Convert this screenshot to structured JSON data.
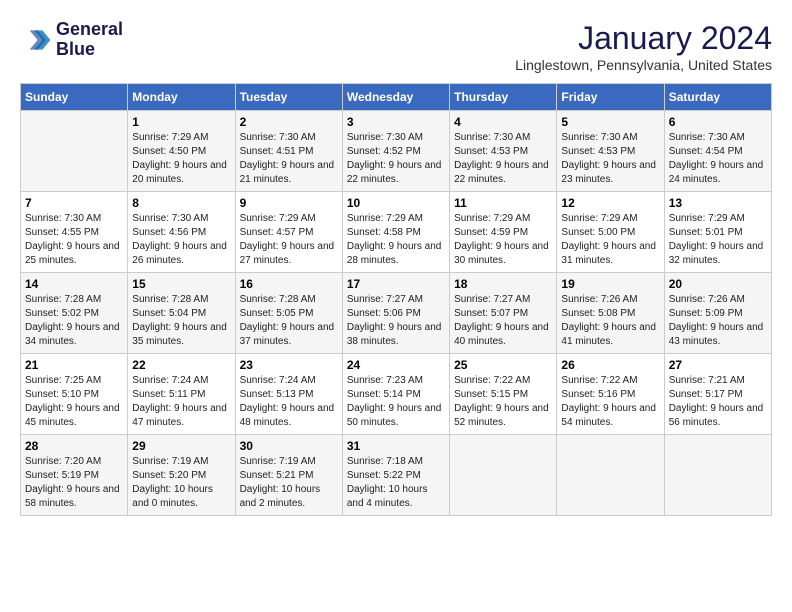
{
  "header": {
    "logo_line1": "General",
    "logo_line2": "Blue",
    "month_title": "January 2024",
    "location": "Linglestown, Pennsylvania, United States"
  },
  "days_of_week": [
    "Sunday",
    "Monday",
    "Tuesday",
    "Wednesday",
    "Thursday",
    "Friday",
    "Saturday"
  ],
  "weeks": [
    [
      {
        "day": "",
        "sunrise": "",
        "sunset": "",
        "daylight": ""
      },
      {
        "day": "1",
        "sunrise": "Sunrise: 7:29 AM",
        "sunset": "Sunset: 4:50 PM",
        "daylight": "Daylight: 9 hours and 20 minutes."
      },
      {
        "day": "2",
        "sunrise": "Sunrise: 7:30 AM",
        "sunset": "Sunset: 4:51 PM",
        "daylight": "Daylight: 9 hours and 21 minutes."
      },
      {
        "day": "3",
        "sunrise": "Sunrise: 7:30 AM",
        "sunset": "Sunset: 4:52 PM",
        "daylight": "Daylight: 9 hours and 22 minutes."
      },
      {
        "day": "4",
        "sunrise": "Sunrise: 7:30 AM",
        "sunset": "Sunset: 4:53 PM",
        "daylight": "Daylight: 9 hours and 22 minutes."
      },
      {
        "day": "5",
        "sunrise": "Sunrise: 7:30 AM",
        "sunset": "Sunset: 4:53 PM",
        "daylight": "Daylight: 9 hours and 23 minutes."
      },
      {
        "day": "6",
        "sunrise": "Sunrise: 7:30 AM",
        "sunset": "Sunset: 4:54 PM",
        "daylight": "Daylight: 9 hours and 24 minutes."
      }
    ],
    [
      {
        "day": "7",
        "sunrise": "Sunrise: 7:30 AM",
        "sunset": "Sunset: 4:55 PM",
        "daylight": "Daylight: 9 hours and 25 minutes."
      },
      {
        "day": "8",
        "sunrise": "Sunrise: 7:30 AM",
        "sunset": "Sunset: 4:56 PM",
        "daylight": "Daylight: 9 hours and 26 minutes."
      },
      {
        "day": "9",
        "sunrise": "Sunrise: 7:29 AM",
        "sunset": "Sunset: 4:57 PM",
        "daylight": "Daylight: 9 hours and 27 minutes."
      },
      {
        "day": "10",
        "sunrise": "Sunrise: 7:29 AM",
        "sunset": "Sunset: 4:58 PM",
        "daylight": "Daylight: 9 hours and 28 minutes."
      },
      {
        "day": "11",
        "sunrise": "Sunrise: 7:29 AM",
        "sunset": "Sunset: 4:59 PM",
        "daylight": "Daylight: 9 hours and 30 minutes."
      },
      {
        "day": "12",
        "sunrise": "Sunrise: 7:29 AM",
        "sunset": "Sunset: 5:00 PM",
        "daylight": "Daylight: 9 hours and 31 minutes."
      },
      {
        "day": "13",
        "sunrise": "Sunrise: 7:29 AM",
        "sunset": "Sunset: 5:01 PM",
        "daylight": "Daylight: 9 hours and 32 minutes."
      }
    ],
    [
      {
        "day": "14",
        "sunrise": "Sunrise: 7:28 AM",
        "sunset": "Sunset: 5:02 PM",
        "daylight": "Daylight: 9 hours and 34 minutes."
      },
      {
        "day": "15",
        "sunrise": "Sunrise: 7:28 AM",
        "sunset": "Sunset: 5:04 PM",
        "daylight": "Daylight: 9 hours and 35 minutes."
      },
      {
        "day": "16",
        "sunrise": "Sunrise: 7:28 AM",
        "sunset": "Sunset: 5:05 PM",
        "daylight": "Daylight: 9 hours and 37 minutes."
      },
      {
        "day": "17",
        "sunrise": "Sunrise: 7:27 AM",
        "sunset": "Sunset: 5:06 PM",
        "daylight": "Daylight: 9 hours and 38 minutes."
      },
      {
        "day": "18",
        "sunrise": "Sunrise: 7:27 AM",
        "sunset": "Sunset: 5:07 PM",
        "daylight": "Daylight: 9 hours and 40 minutes."
      },
      {
        "day": "19",
        "sunrise": "Sunrise: 7:26 AM",
        "sunset": "Sunset: 5:08 PM",
        "daylight": "Daylight: 9 hours and 41 minutes."
      },
      {
        "day": "20",
        "sunrise": "Sunrise: 7:26 AM",
        "sunset": "Sunset: 5:09 PM",
        "daylight": "Daylight: 9 hours and 43 minutes."
      }
    ],
    [
      {
        "day": "21",
        "sunrise": "Sunrise: 7:25 AM",
        "sunset": "Sunset: 5:10 PM",
        "daylight": "Daylight: 9 hours and 45 minutes."
      },
      {
        "day": "22",
        "sunrise": "Sunrise: 7:24 AM",
        "sunset": "Sunset: 5:11 PM",
        "daylight": "Daylight: 9 hours and 47 minutes."
      },
      {
        "day": "23",
        "sunrise": "Sunrise: 7:24 AM",
        "sunset": "Sunset: 5:13 PM",
        "daylight": "Daylight: 9 hours and 48 minutes."
      },
      {
        "day": "24",
        "sunrise": "Sunrise: 7:23 AM",
        "sunset": "Sunset: 5:14 PM",
        "daylight": "Daylight: 9 hours and 50 minutes."
      },
      {
        "day": "25",
        "sunrise": "Sunrise: 7:22 AM",
        "sunset": "Sunset: 5:15 PM",
        "daylight": "Daylight: 9 hours and 52 minutes."
      },
      {
        "day": "26",
        "sunrise": "Sunrise: 7:22 AM",
        "sunset": "Sunset: 5:16 PM",
        "daylight": "Daylight: 9 hours and 54 minutes."
      },
      {
        "day": "27",
        "sunrise": "Sunrise: 7:21 AM",
        "sunset": "Sunset: 5:17 PM",
        "daylight": "Daylight: 9 hours and 56 minutes."
      }
    ],
    [
      {
        "day": "28",
        "sunrise": "Sunrise: 7:20 AM",
        "sunset": "Sunset: 5:19 PM",
        "daylight": "Daylight: 9 hours and 58 minutes."
      },
      {
        "day": "29",
        "sunrise": "Sunrise: 7:19 AM",
        "sunset": "Sunset: 5:20 PM",
        "daylight": "Daylight: 10 hours and 0 minutes."
      },
      {
        "day": "30",
        "sunrise": "Sunrise: 7:19 AM",
        "sunset": "Sunset: 5:21 PM",
        "daylight": "Daylight: 10 hours and 2 minutes."
      },
      {
        "day": "31",
        "sunrise": "Sunrise: 7:18 AM",
        "sunset": "Sunset: 5:22 PM",
        "daylight": "Daylight: 10 hours and 4 minutes."
      },
      {
        "day": "",
        "sunrise": "",
        "sunset": "",
        "daylight": ""
      },
      {
        "day": "",
        "sunrise": "",
        "sunset": "",
        "daylight": ""
      },
      {
        "day": "",
        "sunrise": "",
        "sunset": "",
        "daylight": ""
      }
    ]
  ]
}
